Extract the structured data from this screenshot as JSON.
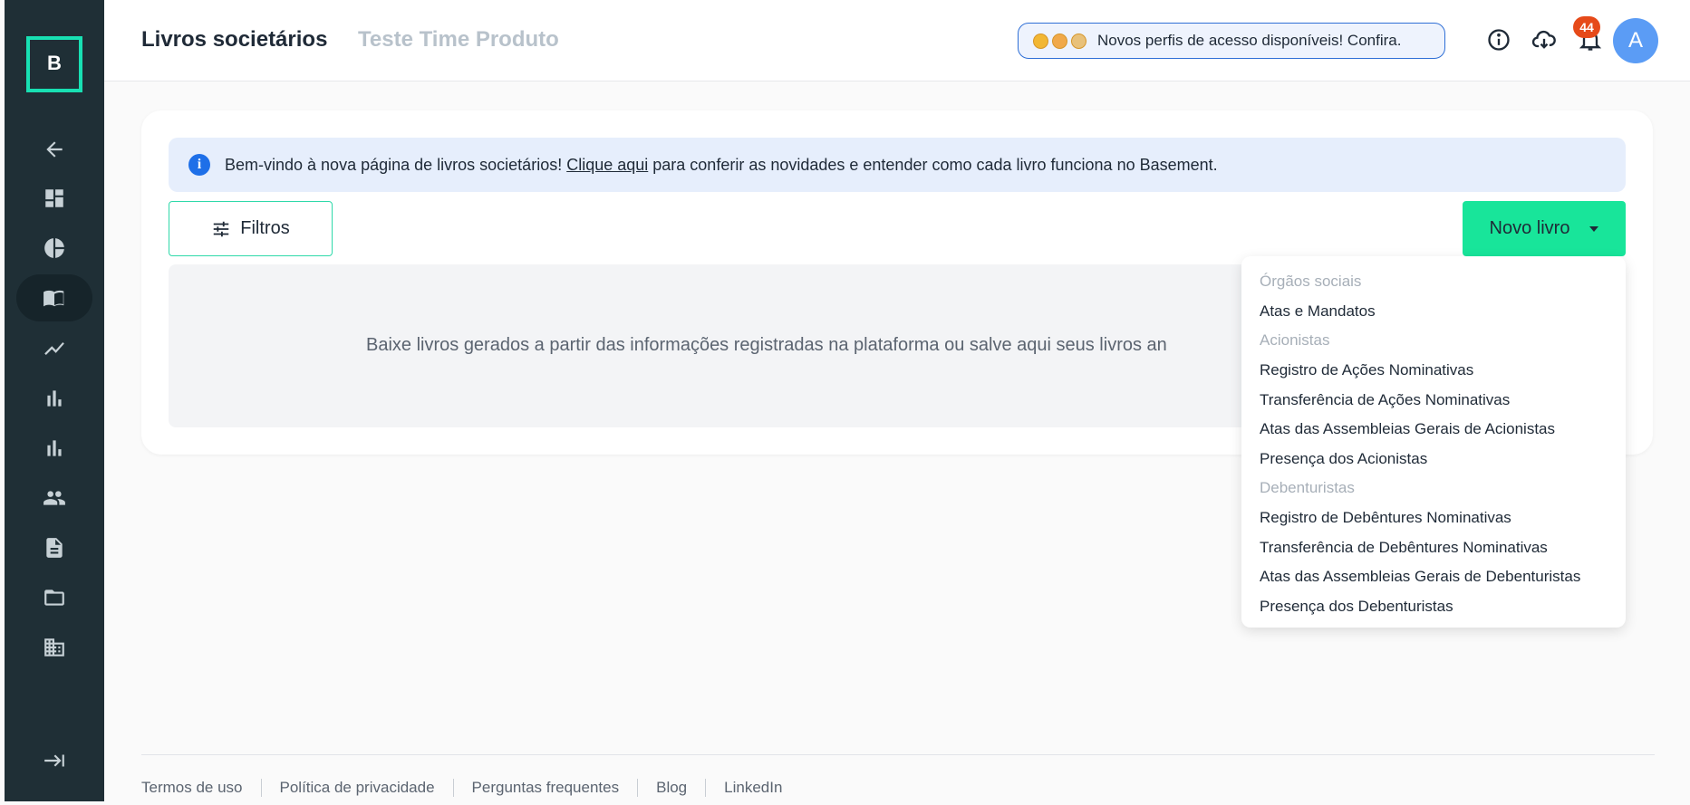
{
  "header": {
    "title": "Livros societários",
    "company": "Teste Time Produto",
    "announcement": "Novos perfis de acesso disponíveis! Confira.",
    "notification_count": "44",
    "avatar_initial": "A"
  },
  "sidebar": {
    "logo_letter": "B",
    "items": [
      {
        "icon": "arrow-left-icon"
      },
      {
        "icon": "dashboard-icon"
      },
      {
        "icon": "pie-chart-icon"
      },
      {
        "icon": "book-icon",
        "active": true
      },
      {
        "icon": "trend-line-icon"
      },
      {
        "icon": "bar-chart-icon"
      },
      {
        "icon": "bar-chart-icon"
      },
      {
        "icon": "people-icon"
      },
      {
        "icon": "document-icon"
      },
      {
        "icon": "folder-icon"
      },
      {
        "icon": "building-icon"
      },
      {
        "icon": "expand-icon"
      }
    ]
  },
  "banner": {
    "text_before": "Bem-vindo à nova página de livros societários!",
    "link": "Clique aqui",
    "text_after": "para conferir as novidades e entender como cada livro funciona no Basement."
  },
  "toolbar": {
    "filter_label": "Filtros",
    "new_book_label": "Novo livro"
  },
  "empty_state": {
    "text": "Baixe livros gerados a partir das informações registradas na plataforma ou salve aqui seus livros an"
  },
  "dropdown": {
    "groups": [
      {
        "label": "Órgãos sociais",
        "items": [
          "Atas e Mandatos"
        ]
      },
      {
        "label": "Acionistas",
        "items": [
          "Registro de Ações Nominativas",
          "Transferência de Ações Nominativas",
          "Atas das Assembleias Gerais de Acionistas",
          "Presença dos Acionistas"
        ]
      },
      {
        "label": "Debenturistas",
        "items": [
          "Registro de Debêntures Nominativas",
          "Transferência de Debêntures Nominativas",
          "Atas das Assembleias Gerais de Debenturistas",
          "Presença dos Debenturistas"
        ]
      }
    ]
  },
  "footer": {
    "links": [
      "Termos de uso",
      "Política de privacidade",
      "Perguntas frequentes",
      "Blog",
      "LinkedIn"
    ]
  },
  "colors": {
    "sidebar": "#1f2f36",
    "accent": "#18e59a",
    "logo": "#18e0b3",
    "badge": "#e64a19",
    "avatar": "#5b9cf5"
  }
}
